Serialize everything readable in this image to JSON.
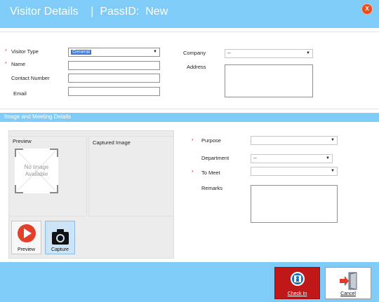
{
  "header": {
    "title": "Visitor Details    |  PassID:  New",
    "close_label": "X"
  },
  "visitor": {
    "visitor_type_label": "Visitor Type",
    "visitor_type_value": "General",
    "name_label": "Name",
    "contact_label": "Contact Number",
    "email_label": "Email",
    "company_label": "Company",
    "company_value": "--",
    "address_label": "Address"
  },
  "section": {
    "title": "Image  and Meeting Details"
  },
  "image": {
    "preview_label": "Preview",
    "captured_label": "Captured Image",
    "no_image_line1": "No Image",
    "no_image_line2": "Available",
    "preview_button": "Preview",
    "capture_button": "Capture"
  },
  "meeting": {
    "purpose_label": "Purpose",
    "department_label": "Department",
    "department_value": "--",
    "to_meet_label": "To Meet",
    "remarks_label": "Remarks"
  },
  "required_marker": "*",
  "footer": {
    "checkin_label": "Check In",
    "cancel_label": "Cancel"
  },
  "colors": {
    "header": "#7fccf8",
    "accent_red": "#c01818",
    "required": "#e0282a"
  }
}
